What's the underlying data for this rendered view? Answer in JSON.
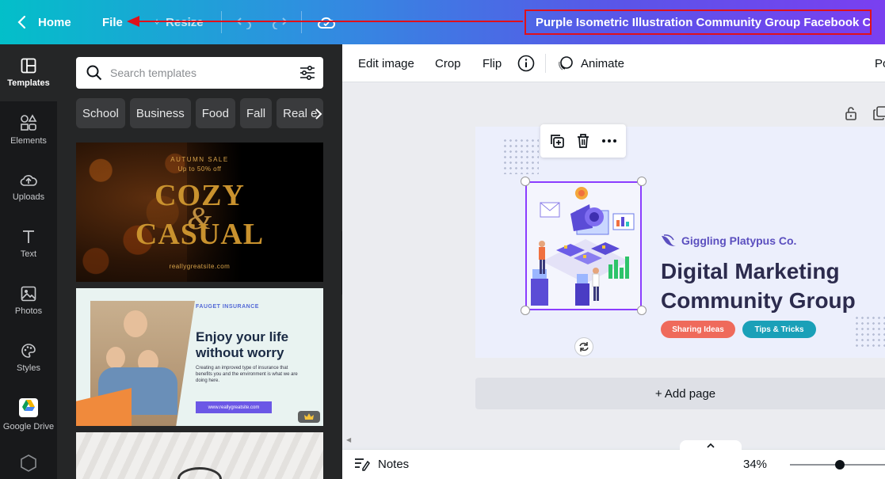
{
  "topbar": {
    "home_label": "Home",
    "file_label": "File",
    "resize_label": "Resize",
    "doc_title": "Purple Isometric Illustration Community Group Facebook C..."
  },
  "rail": {
    "items": [
      {
        "label": "Templates",
        "icon": "templates-icon"
      },
      {
        "label": "Elements",
        "icon": "elements-icon"
      },
      {
        "label": "Uploads",
        "icon": "uploads-icon"
      },
      {
        "label": "Text",
        "icon": "text-icon"
      },
      {
        "label": "Photos",
        "icon": "photos-icon"
      },
      {
        "label": "Styles",
        "icon": "styles-icon"
      },
      {
        "label": "Google Drive",
        "icon": "google-drive-icon"
      }
    ]
  },
  "panel": {
    "search_placeholder": "Search templates",
    "chips": [
      "School",
      "Business",
      "Food",
      "Fall",
      "Real e"
    ],
    "templates": [
      {
        "top_text": "AUTUMN SALE",
        "sub_text": "Up to 50% off",
        "title_1": "COZY",
        "amp": "&",
        "title_2": "CASUAL",
        "url": "reallygreatsite.com"
      },
      {
        "brand": "FAUGET INSURANCE",
        "headline": "Enjoy your life without worry",
        "body": "Creating an improved type of insurance that benefits you and the environment is what we are doing here.",
        "url": "www.reallygreatsite.com"
      }
    ]
  },
  "toolbar": {
    "edit_image": "Edit image",
    "crop": "Crop",
    "flip": "Flip",
    "animate": "Animate",
    "position_partial": "Po"
  },
  "design": {
    "brand_name": "Giggling Platypus Co.",
    "headline": "Digital Marketing Community Group",
    "pill_1": "Sharing Ideas",
    "pill_2": "Tips & Tricks",
    "colors": {
      "pill_1": "#ef6a5b",
      "pill_2": "#1aa0b8",
      "accent": "#8b3dff"
    }
  },
  "canvas": {
    "add_page": "+ Add page"
  },
  "footer": {
    "notes": "Notes",
    "zoom": "34%",
    "zoom_level": 0.34
  }
}
